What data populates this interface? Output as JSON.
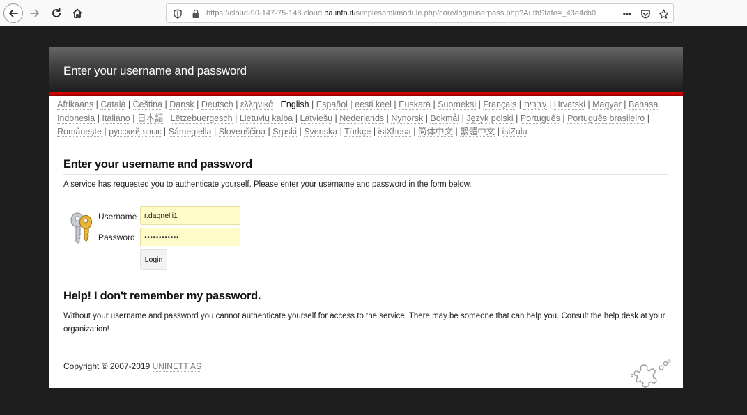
{
  "browser": {
    "url_prefix": "https://cloud-90-147-75-148.cloud.",
    "url_domain": "ba.infn.it",
    "url_suffix": "/simplesaml/module.php/core/loginuserpass.php?AuthState=_43e4cb0",
    "menu_glyph": "•••"
  },
  "header": {
    "title": "Enter your username and password"
  },
  "languages": [
    {
      "label": "Afrikaans"
    },
    {
      "label": "Català"
    },
    {
      "label": "Čeština"
    },
    {
      "label": "Dansk"
    },
    {
      "label": "Deutsch"
    },
    {
      "label": "ελληνικά"
    },
    {
      "label": "English",
      "current": true
    },
    {
      "label": "Español"
    },
    {
      "label": "eesti keel"
    },
    {
      "label": "Euskara"
    },
    {
      "label": "Suomeksi"
    },
    {
      "label": "Français"
    },
    {
      "label": "עַבְרִית"
    },
    {
      "label": "Hrvatski"
    },
    {
      "label": "Magyar"
    },
    {
      "label": "Bahasa Indonesia"
    },
    {
      "label": "Italiano"
    },
    {
      "label": "日本語"
    },
    {
      "label": "Lëtzebuergesch"
    },
    {
      "label": "Lietuvių kalba"
    },
    {
      "label": "Latviešu"
    },
    {
      "label": "Nederlands"
    },
    {
      "label": "Nynorsk"
    },
    {
      "label": "Bokmål"
    },
    {
      "label": "Język polski"
    },
    {
      "label": "Português"
    },
    {
      "label": "Português brasileiro"
    },
    {
      "label": "Românește"
    },
    {
      "label": "русский язык"
    },
    {
      "label": "Sámegiella"
    },
    {
      "label": "Slovenščina"
    },
    {
      "label": "Srpski"
    },
    {
      "label": "Svenska"
    },
    {
      "label": "Türkçe"
    },
    {
      "label": "isiXhosa"
    },
    {
      "label": "简体中文"
    },
    {
      "label": "繁體中文"
    },
    {
      "label": "isiZulu"
    }
  ],
  "login": {
    "heading": "Enter your username and password",
    "intro": "A service has requested you to authenticate yourself. Please enter your username and password in the form below.",
    "username_label": "Username",
    "username_value": "r.dagnelli1",
    "password_label": "Password",
    "password_value": "••••••••••••",
    "login_button": "Login"
  },
  "help": {
    "heading": "Help! I don't remember my password.",
    "text": "Without your username and password you cannot authenticate yourself for access to the service. There may be someone that can help you. Consult the help desk at your organization!"
  },
  "footer": {
    "copyright": "Copyright © 2007-2019",
    "link": "UNINETT AS"
  },
  "colors": {
    "accent_red": "#cc0000",
    "input_bg": "#fffbc8"
  }
}
